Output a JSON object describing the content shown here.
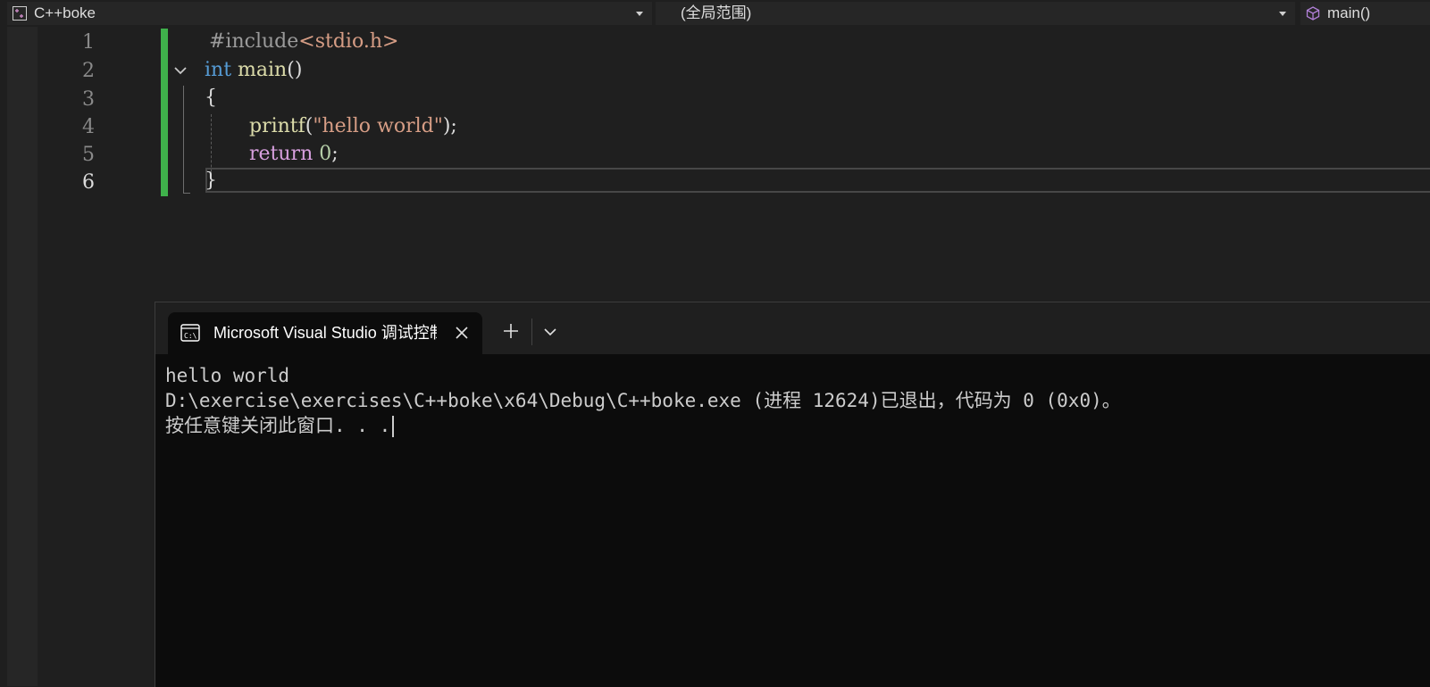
{
  "navbar": {
    "project": "C++boke",
    "scope": "(全局范围)",
    "member": "main()"
  },
  "editor": {
    "line_numbers": [
      "1",
      "2",
      "3",
      "4",
      "5",
      "6"
    ],
    "current_line": 6,
    "lines": {
      "l1": {
        "directive": "#include",
        "header": "<stdio.h>"
      },
      "l2": {
        "type": "int",
        "func": "main",
        "parens": "()"
      },
      "l3": {
        "brace": "{"
      },
      "l4": {
        "func": "printf",
        "open": "(",
        "str": "\"hello world\"",
        "close": ");"
      },
      "l5": {
        "keyword": "return",
        "number": "0",
        "semi": ";"
      },
      "l6": {
        "brace": "}"
      }
    },
    "colors": {
      "change_bar": "#3fb14b",
      "keyword": "#569cd6",
      "function": "#dcdcaa",
      "string": "#d69d85",
      "control": "#d8a0df"
    }
  },
  "console": {
    "tab_title": "Microsoft Visual Studio 调试控制台",
    "tab_icon": "console-icon",
    "output": [
      "hello world",
      "D:\\exercise\\exercises\\C++boke\\x64\\Debug\\C++boke.exe (进程 12624)已退出，代码为 0 (0x0)。",
      "按任意键关闭此窗口. . ."
    ]
  }
}
